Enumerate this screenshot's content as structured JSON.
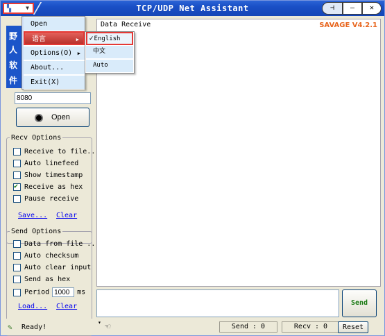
{
  "window": {
    "title": "TCP/UDP Net Assistant",
    "brand": "SAVAGE V4.2.1",
    "colors": {
      "titlebar": "#1a4fc5",
      "highlight": "#e53935",
      "brand": "#e8661e",
      "send_text": "#1a7a14"
    }
  },
  "system_menu": {
    "icon": "app-icon",
    "items": [
      {
        "label": "Open",
        "has_submenu": false
      },
      {
        "label": "语言",
        "has_submenu": true,
        "highlighted": true
      },
      {
        "label": "Options(O)",
        "has_submenu": true
      },
      {
        "label": "About...",
        "has_submenu": false
      },
      {
        "label": "Exit(X)",
        "has_submenu": false
      }
    ]
  },
  "language_submenu": {
    "items": [
      {
        "label": "English",
        "checked": true
      },
      {
        "label": "中文",
        "checked": false
      },
      {
        "label": "Auto",
        "checked": false
      }
    ]
  },
  "side_chars": [
    "野",
    "人",
    "软",
    "件"
  ],
  "connection": {
    "port_value": "8080",
    "open_label": "Open"
  },
  "recv_options": {
    "legend": "Recv Options",
    "options": [
      {
        "label": "Receive to file...",
        "checked": false
      },
      {
        "label": "Auto linefeed",
        "checked": false
      },
      {
        "label": "Show timestamp",
        "checked": false
      },
      {
        "label": "Receive as hex",
        "checked": true
      },
      {
        "label": "Pause receive",
        "checked": false
      }
    ],
    "save_link": "Save...",
    "clear_link": "Clear"
  },
  "send_options": {
    "legend": "Send Options",
    "options": [
      {
        "label": "Data from file ...",
        "checked": false
      },
      {
        "label": "Auto checksum",
        "checked": false
      },
      {
        "label": "Auto clear input",
        "checked": false
      },
      {
        "label": "Send as hex",
        "checked": false
      }
    ],
    "period_label": "Period",
    "period_value": "1000",
    "period_unit": "ms",
    "load_link": "Load...",
    "clear_link": "Clear"
  },
  "receive_area": {
    "legend": "Data Receive"
  },
  "send_area": {
    "send_label": "Send"
  },
  "status": {
    "text": "Ready!",
    "send_count": "Send : 0",
    "recv_count": "Recv : 0",
    "reset_label": "Reset"
  }
}
